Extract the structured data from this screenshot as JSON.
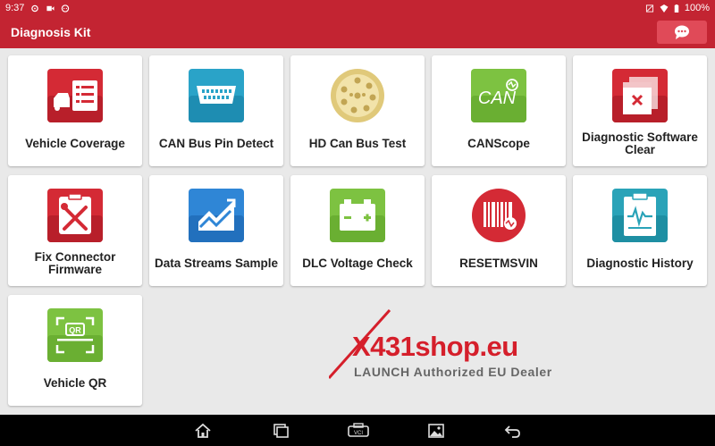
{
  "status": {
    "time": "9:37",
    "battery": "100%"
  },
  "app": {
    "title": "Diagnosis Kit"
  },
  "colors": {
    "brand": "#c32432",
    "tile_bg": "#ffffff"
  },
  "tiles": [
    {
      "label": "Vehicle Coverage",
      "icon": "vehicle-list-icon"
    },
    {
      "label": "CAN Bus Pin Detect",
      "icon": "obd-connector-icon"
    },
    {
      "label": "HD Can Bus Test",
      "icon": "round-connector-icon"
    },
    {
      "label": "CANScope",
      "icon": "canscope-icon"
    },
    {
      "label": "Diagnostic Software Clear",
      "icon": "clear-window-icon"
    },
    {
      "label": "Fix Connector Firmware",
      "icon": "repair-tools-icon"
    },
    {
      "label": "Data Streams Sample",
      "icon": "line-chart-icon"
    },
    {
      "label": "DLC Voltage Check",
      "icon": "battery-icon"
    },
    {
      "label": "RESETMSVIN",
      "icon": "barcode-icon"
    },
    {
      "label": "Diagnostic History",
      "icon": "clipboard-wave-icon"
    },
    {
      "label": "Vehicle QR",
      "icon": "qr-scan-icon"
    }
  ],
  "watermark": {
    "text": "X431shop.eu",
    "tagline": "LAUNCH Authorized EU Dealer"
  },
  "icons": {
    "can_text": "CAN",
    "qr_text": "QR",
    "vci_text": "VCI"
  }
}
